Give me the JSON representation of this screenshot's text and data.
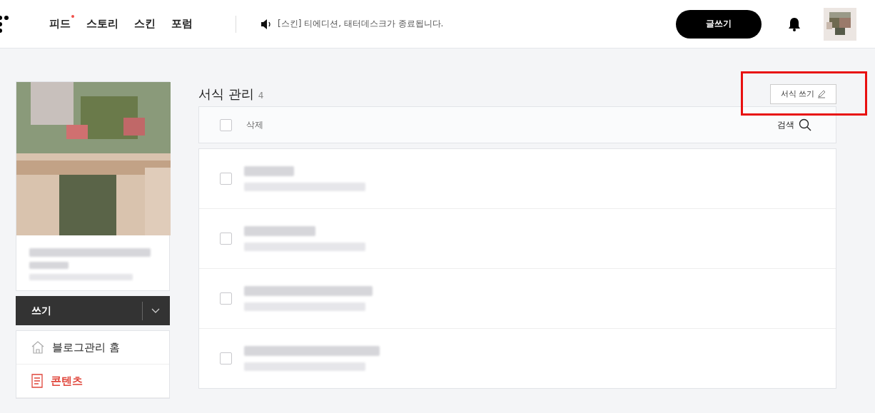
{
  "header": {
    "nav": [
      {
        "label": "피드",
        "new": true
      },
      {
        "label": "스토리",
        "new": false
      },
      {
        "label": "스킨",
        "new": false
      },
      {
        "label": "포럼",
        "new": false
      }
    ],
    "notice": "[스킨] 티에디션, 태터데스크가 종료됩니다.",
    "write_button": "글쓰기"
  },
  "sidebar": {
    "write_button": "쓰기",
    "menu": [
      {
        "label": "블로그관리 홈",
        "kind": "home",
        "selected": false
      },
      {
        "label": "콘텐츠",
        "kind": "doc",
        "selected": true
      }
    ]
  },
  "main": {
    "title": "서식 관리",
    "count": "4",
    "new_button": "서식 쓰기",
    "new_button_highlighted": true,
    "toolbar": {
      "delete": "삭제",
      "search": "검색",
      "checked": false
    },
    "rows": [
      {
        "checked": false
      },
      {
        "checked": false
      },
      {
        "checked": false
      },
      {
        "checked": false
      }
    ]
  }
}
